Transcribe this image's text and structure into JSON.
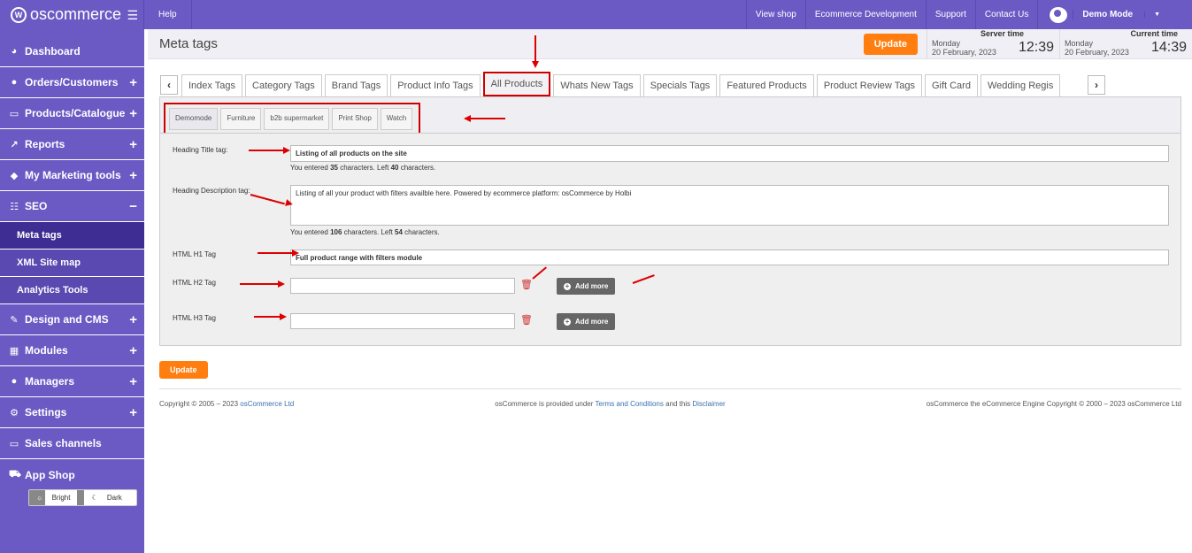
{
  "app": {
    "logo": "oscommerce",
    "help": "Help"
  },
  "top_links": [
    "View shop",
    "Ecommerce Development",
    "Support",
    "Contact Us"
  ],
  "user": {
    "name": "Demo Mode"
  },
  "sidebar": {
    "items": [
      {
        "label": "Dashboard",
        "icon": "dashboard-icon",
        "plus": ""
      },
      {
        "label": "Orders/Customers",
        "icon": "users-icon",
        "plus": "+"
      },
      {
        "label": "Products/Catalogue",
        "icon": "folder-icon",
        "plus": "+"
      },
      {
        "label": "Reports",
        "icon": "chart-icon",
        "plus": "+"
      },
      {
        "label": "My Marketing tools",
        "icon": "tag-icon",
        "plus": "+"
      },
      {
        "label": "SEO",
        "icon": "seo-icon",
        "plus": "−"
      }
    ],
    "seo_sub": [
      "Meta tags",
      "XML Site map",
      "Analytics Tools"
    ],
    "items2": [
      {
        "label": "Design and CMS",
        "icon": "brush-icon",
        "plus": "+"
      },
      {
        "label": "Modules",
        "icon": "modules-icon",
        "plus": "+"
      },
      {
        "label": "Managers",
        "icon": "user-icon",
        "plus": "+"
      },
      {
        "label": "Settings",
        "icon": "gear-icon",
        "plus": "+"
      },
      {
        "label": "Sales channels",
        "icon": "monitor-icon",
        "plus": ""
      },
      {
        "label": "App Shop",
        "icon": "cart-icon",
        "plus": ""
      }
    ],
    "theme": {
      "bright": "Bright",
      "dark": "Dark"
    }
  },
  "header": {
    "title": "Meta tags",
    "update": "Update",
    "server_time": {
      "label": "Server time",
      "day": "Monday",
      "date": "20 February, 2023",
      "time": "12:39"
    },
    "current_time": {
      "label": "Current time",
      "day": "Monday",
      "date": "20 February, 2023",
      "time": "14:39"
    }
  },
  "tabs": [
    "Index Tags",
    "Category Tags",
    "Brand Tags",
    "Product Info Tags",
    "All Products",
    "Whats New Tags",
    "Specials Tags",
    "Featured Products",
    "Product Review Tags",
    "Gift Card",
    "Wedding Regis"
  ],
  "subtabs": [
    "Demomode",
    "Furniture",
    "b2b supermarket",
    "Print Shop",
    "Watch"
  ],
  "form": {
    "heading_title_label": "Heading Title tag:",
    "heading_title_value": "Listing of all products on the site",
    "heading_title_note": {
      "a": "You entered ",
      "n1": "35",
      "b": " characters. Left ",
      "n2": "40",
      "c": " characters."
    },
    "heading_desc_label": "Heading Description tag:",
    "heading_desc_value": "Listing of all your product with filters availble here. Powered by ecommerce platform: osCommerce by Holbi",
    "heading_desc_note": {
      "a": "You entered ",
      "n1": "106",
      "b": " characters. Left ",
      "n2": "54",
      "c": " characters."
    },
    "h1_label": "HTML H1 Tag",
    "h1_value": "Full product range with filters module",
    "h2_label": "HTML H2 Tag",
    "h3_label": "HTML H3 Tag",
    "add_more": "Add more"
  },
  "update_button": "Update",
  "footer": {
    "left": "Copyright © 2005 – 2023 ",
    "left_link": "osCommerce Ltd",
    "mid_a": "osCommerce is provided under ",
    "mid_link1": "Terms and Conditions",
    "mid_b": " and this ",
    "mid_link2": "Disclaimer",
    "right": "osCommerce the eCommerce Engine Copyright © 2000 – 2023 osCommerce Ltd"
  }
}
